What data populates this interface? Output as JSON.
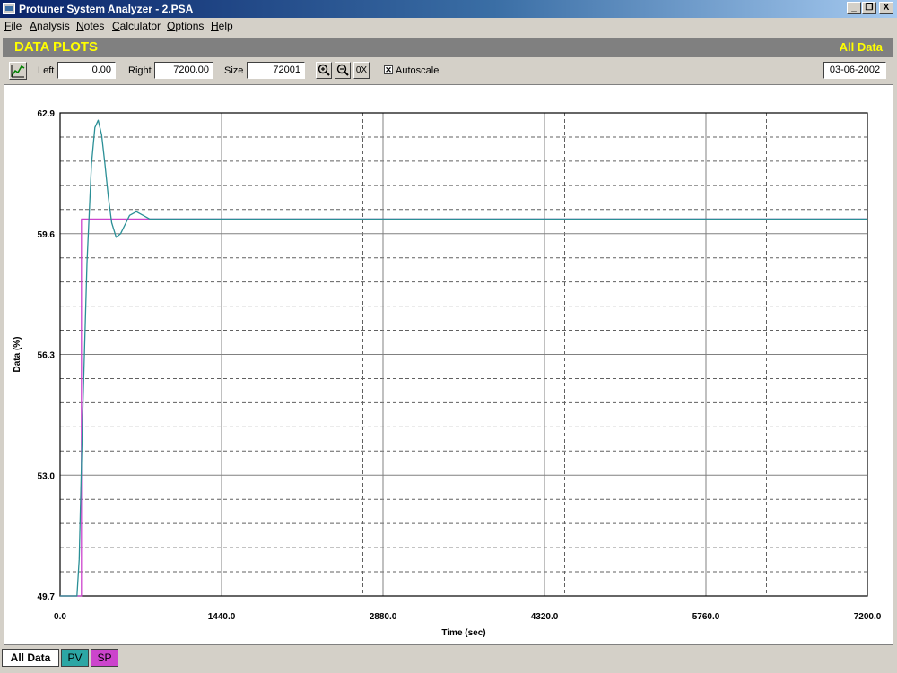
{
  "window": {
    "title": "Protuner System Analyzer - 2.PSA",
    "controls": [
      "_",
      "̲❐",
      "X"
    ]
  },
  "menu": [
    "File",
    "Analysis",
    "Notes",
    "Calculator",
    "Options",
    "Help"
  ],
  "header": {
    "title": "DATA PLOTS",
    "scope": "All Data"
  },
  "toolbar": {
    "left_label": "Left",
    "left_value": "0.00",
    "right_label": "Right",
    "right_value": "7200.00",
    "size_label": "Size",
    "size_value": "72001",
    "zoom_in": "+",
    "zoom_out": "−",
    "zero_x": "0X",
    "autoscale_label": "Autoscale",
    "autoscale_checked": true,
    "date": "03-06-2002"
  },
  "tabs": [
    {
      "label": "All Data",
      "color": "#ffffff"
    },
    {
      "label": "PV",
      "color": "#2ca6a4"
    },
    {
      "label": "SP",
      "color": "#cc44cc"
    }
  ],
  "chart_data": {
    "type": "line",
    "xlabel": "Time (sec)",
    "ylabel": "Data (%)",
    "xlim": [
      0.0,
      7200.0
    ],
    "ylim": [
      49.7,
      62.9
    ],
    "x_ticks": [
      "0.0",
      "1440.0",
      "2880.0",
      "4320.0",
      "5760.0",
      "7200.0"
    ],
    "y_ticks": [
      "49.7",
      "53.0",
      "56.3",
      "59.6",
      "62.9"
    ],
    "grid": true,
    "series": [
      {
        "name": "PV",
        "color": "#2a8f96",
        "x": [
          0,
          150,
          170,
          200,
          240,
          280,
          310,
          340,
          370,
          400,
          430,
          460,
          500,
          540,
          580,
          620,
          680,
          740,
          800,
          900,
          1500,
          3000,
          4500,
          7200
        ],
        "y": [
          49.7,
          49.7,
          50.7,
          54.5,
          58.8,
          61.5,
          62.5,
          62.7,
          62.3,
          61.5,
          60.6,
          59.9,
          59.5,
          59.6,
          59.85,
          60.1,
          60.2,
          60.1,
          60.0,
          60.0,
          60.0,
          60.0,
          60.0,
          60.0
        ]
      },
      {
        "name": "SP",
        "color": "#cc44cc",
        "x": [
          0,
          190,
          190,
          7200
        ],
        "y": [
          49.7,
          49.7,
          60.0,
          60.0
        ]
      }
    ]
  }
}
